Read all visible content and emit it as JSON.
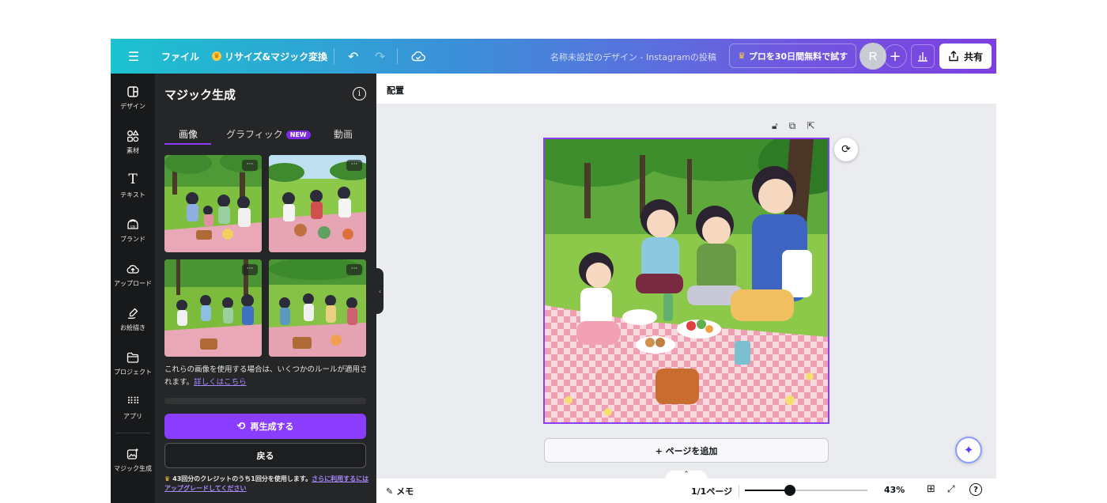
{
  "topbar": {
    "file_label": "ファイル",
    "resize_label": "リサイズ&マジック変換",
    "doc_title": "名称未設定のデザイン - Instagramの投稿",
    "pro_label": "プロを30日間無料で試す",
    "avatar_initial": "R",
    "share_label": "共有"
  },
  "rail": {
    "items": [
      {
        "label": "デザイン",
        "icon": "layout-icon"
      },
      {
        "label": "素材",
        "icon": "shapes-icon"
      },
      {
        "label": "テキスト",
        "icon": "text-icon"
      },
      {
        "label": "ブランド",
        "icon": "brand-icon"
      },
      {
        "label": "アップロード",
        "icon": "upload-icon"
      },
      {
        "label": "お絵描き",
        "icon": "draw-icon"
      },
      {
        "label": "プロジェクト",
        "icon": "folder-icon"
      },
      {
        "label": "アプリ",
        "icon": "apps-icon"
      },
      {
        "label": "マジック生成",
        "icon": "magic-media-icon"
      }
    ]
  },
  "panel": {
    "title": "マジック生成",
    "tabs": [
      {
        "label": "画像",
        "active": true
      },
      {
        "label": "グラフィック",
        "badge": "NEW"
      },
      {
        "label": "動画"
      }
    ],
    "rules_text": "これらの画像を使用する場合は、いくつかのルールが適用されます。",
    "rules_link": "詳しくはこちら",
    "regenerate_label": "再生成する",
    "back_label": "戻る",
    "credits_text": "43回分のクレジットのうち1回分を使用します。",
    "credits_link": "さらに利用するにはアップグレードしてください"
  },
  "canvas": {
    "header_label": "配置",
    "add_page_label": "+ ページを追加"
  },
  "footer": {
    "notes_label": "メモ",
    "page_count": "1/1ページ",
    "zoom_value": "43%",
    "zoom_fraction": 0.37
  },
  "colors": {
    "accent": "#8b3dff",
    "topbar_start": "#1cc2cf",
    "topbar_end": "#7d3fe0",
    "panel_bg": "#252627",
    "rail_bg": "#18191b"
  }
}
